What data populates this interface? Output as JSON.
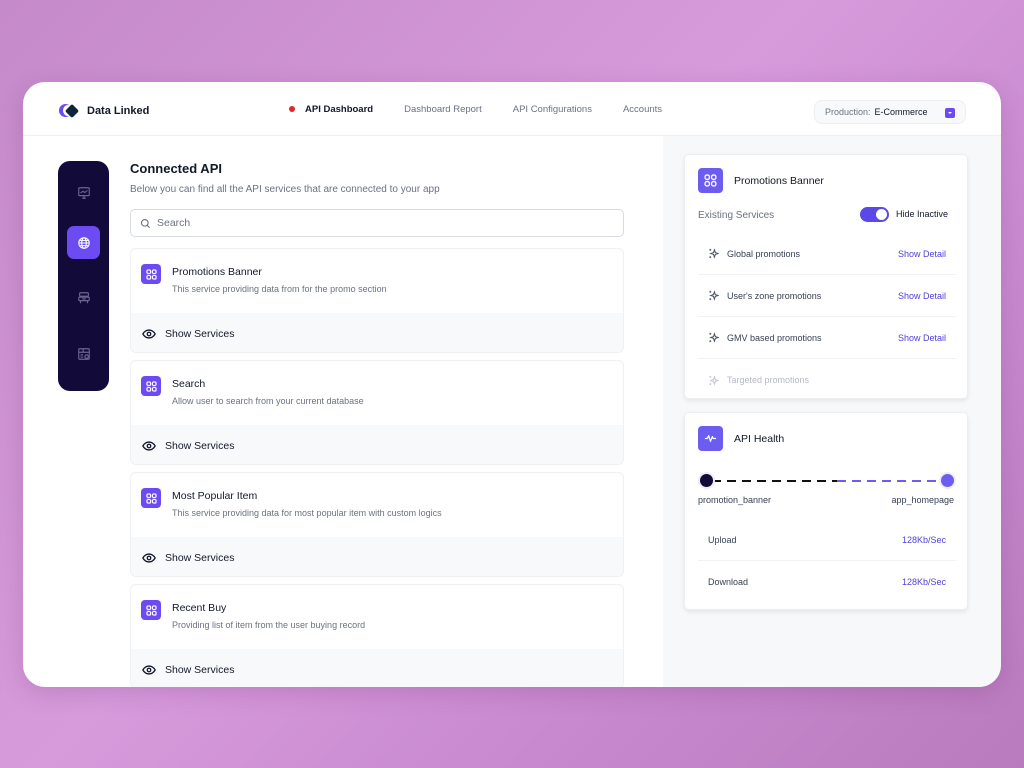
{
  "app": {
    "name": "Data Linked"
  },
  "nav": {
    "items": [
      {
        "label": "API Dashboard",
        "active": true
      },
      {
        "label": "Dashboard Report",
        "active": false
      },
      {
        "label": "API Configurations",
        "active": false
      },
      {
        "label": "Accounts",
        "active": false
      }
    ]
  },
  "environment": {
    "label": "Production:",
    "value": "E-Commerce"
  },
  "rail": {
    "items": [
      {
        "icon": "monitor-icon",
        "active": false
      },
      {
        "icon": "globe-icon",
        "active": true
      },
      {
        "icon": "server-icon",
        "active": false
      },
      {
        "icon": "report-icon",
        "active": false
      }
    ]
  },
  "main": {
    "title": "Connected API",
    "subtitle": "Below you can find all the API services that are connected to your app",
    "search": {
      "placeholder": "Search",
      "value": ""
    },
    "show_services_label": "Show Services",
    "cards": [
      {
        "title": "Promotions Banner",
        "description": "This service providing data from for the promo section"
      },
      {
        "title": "Search",
        "description": "Allow user to search from your current database"
      },
      {
        "title": "Most Popular Item",
        "description": "This service providing data for most popular item with custom logics"
      },
      {
        "title": "Recent Buy",
        "description": "Providing list of item from the user buying record"
      }
    ]
  },
  "promotions_panel": {
    "title": "Promotions Banner",
    "existing_label": "Existing Services",
    "toggle": {
      "label": "Hide Inactive",
      "on": true
    },
    "link_label": "Show Detail",
    "services": [
      {
        "name": "Global promotions",
        "active": true
      },
      {
        "name": "User's zone promotions",
        "active": true
      },
      {
        "name": "GMV based promotions",
        "active": true
      },
      {
        "name": "Targeted promotions",
        "active": false
      }
    ]
  },
  "health_panel": {
    "title": "API Health",
    "source": "promotion_banner",
    "target": "app_homepage",
    "metrics": [
      {
        "name": "Upload",
        "value": "128Kb/Sec"
      },
      {
        "name": "Download",
        "value": "128Kb/Sec"
      }
    ]
  },
  "colors": {
    "accent": "#6c4cf2",
    "rail_bg": "#120a39",
    "link": "#4f3fd9",
    "active_dot": "#e5252a"
  }
}
